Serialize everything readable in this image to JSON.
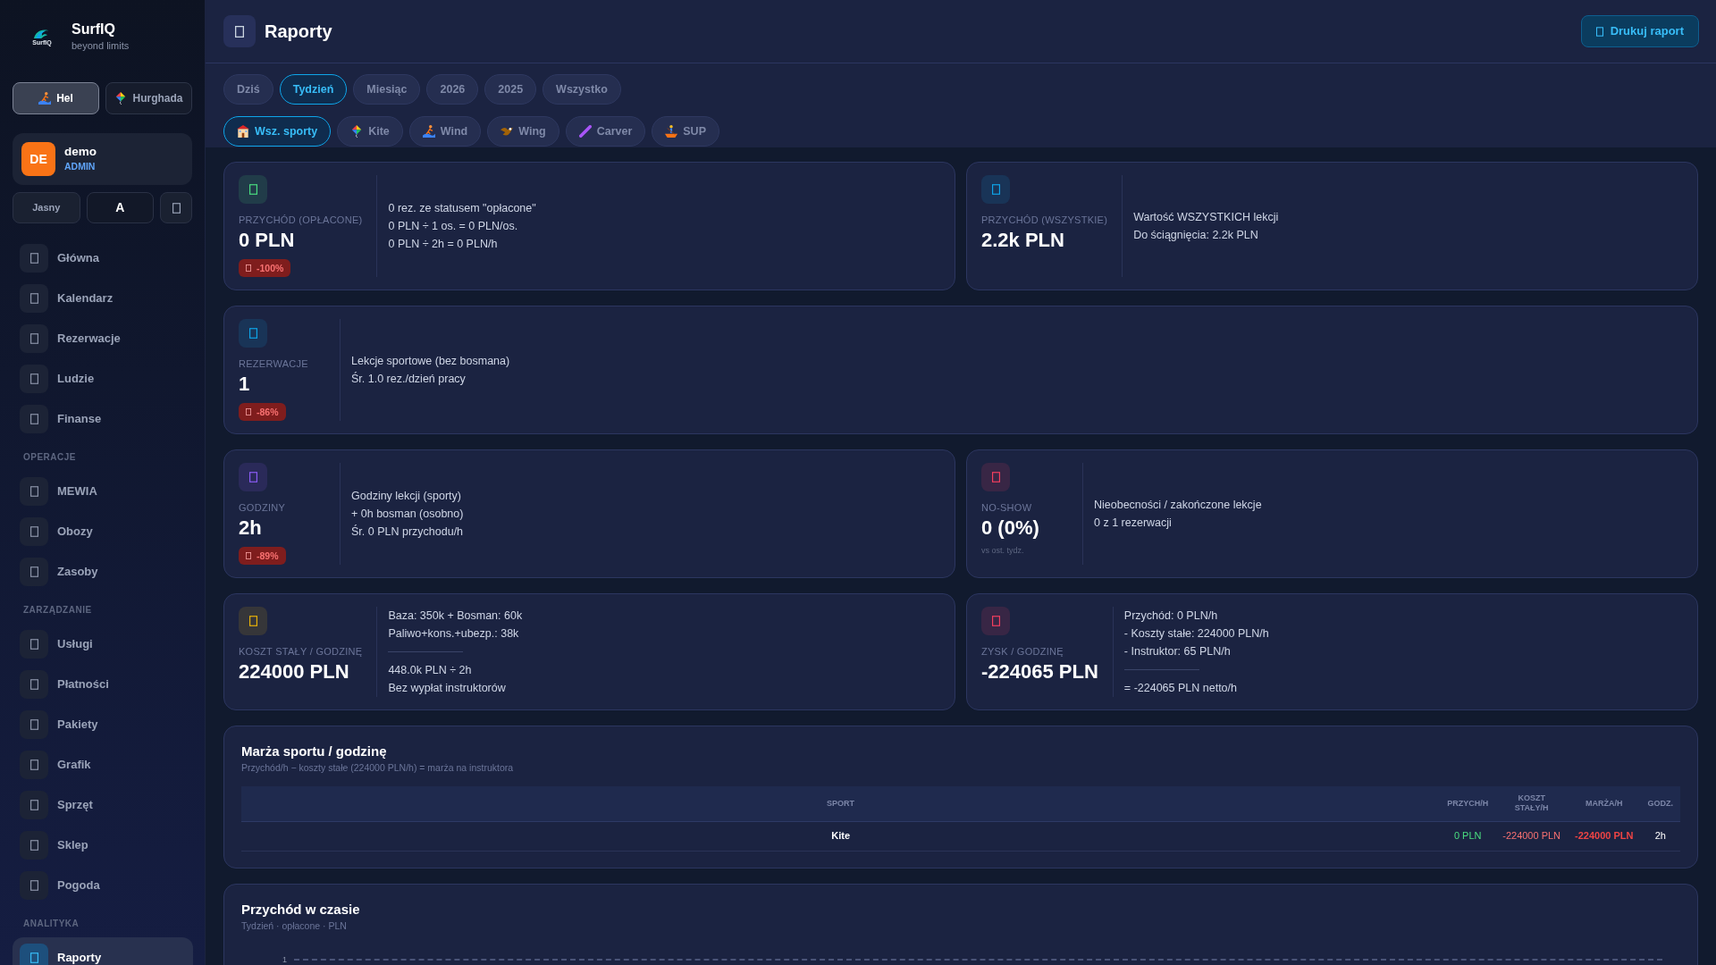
{
  "sidebar": {
    "logo_text": "SurfIQ",
    "brand": "SurfIQ",
    "tagline": "beyond limits",
    "locations": [
      {
        "label": "Hel",
        "selected": true
      },
      {
        "label": "Hurghada",
        "selected": false
      }
    ],
    "user": {
      "initials": "DE",
      "name": "demo",
      "role": "ADMIN"
    },
    "theme_buttons": [
      {
        "label": "Jasny",
        "selected": false
      },
      {
        "label": "A",
        "selected": true
      }
    ],
    "nav_sections": [
      {
        "items": [
          {
            "label": "Główna",
            "selected": false
          },
          {
            "label": "Kalendarz",
            "selected": false
          },
          {
            "label": "Rezerwacje",
            "selected": false
          },
          {
            "label": "Ludzie",
            "selected": false
          },
          {
            "label": "Finanse",
            "selected": false
          }
        ]
      },
      {
        "heading": "OPERACJE",
        "items": [
          {
            "label": "MEWIA",
            "selected": false
          },
          {
            "label": "Obozy",
            "selected": false
          },
          {
            "label": "Zasoby",
            "selected": false
          }
        ]
      },
      {
        "heading": "ZARZĄDZANIE",
        "items": [
          {
            "label": "Usługi",
            "selected": false
          },
          {
            "label": "Płatności",
            "selected": false
          },
          {
            "label": "Pakiety",
            "selected": false
          },
          {
            "label": "Grafik",
            "selected": false
          },
          {
            "label": "Sprzęt",
            "selected": false
          },
          {
            "label": "Sklep",
            "selected": false
          },
          {
            "label": "Pogoda",
            "selected": false
          }
        ]
      },
      {
        "heading": "ANALITYKA",
        "items": [
          {
            "label": "Raporty",
            "selected": true
          }
        ]
      }
    ]
  },
  "header": {
    "title": "Raporty",
    "print_button": "Drukuj raport"
  },
  "period_filters": [
    {
      "label": "Dziś",
      "selected": false
    },
    {
      "label": "Tydzień",
      "selected": true
    },
    {
      "label": "Miesiąc",
      "selected": false
    },
    {
      "label": "2026",
      "selected": false
    },
    {
      "label": "2025",
      "selected": false
    },
    {
      "label": "Wszystko",
      "selected": false
    }
  ],
  "sport_filters": [
    {
      "label": "Wsz. sporty",
      "selected": true
    },
    {
      "label": "Kite",
      "selected": false
    },
    {
      "label": "Wind",
      "selected": false
    },
    {
      "label": "Wing",
      "selected": false
    },
    {
      "label": "Carver",
      "selected": false
    },
    {
      "label": "SUP",
      "selected": false
    }
  ],
  "stat_rows": [
    [
      {
        "label": "PRZYCHÓD (OPŁACONE)",
        "value": "0 PLN",
        "delta": "-100%",
        "color": "#4ade80",
        "details": [
          [
            "0 rez. ze statusem \"opłacone\"",
            "0 PLN ÷ 1 os. = 0 PLN/os.",
            "0 PLN ÷ 2h = 0 PLN/h"
          ]
        ]
      },
      {
        "label": "PRZYCHÓD (WSZYSTKIE)",
        "value": "2.2k PLN",
        "color": "#0ea5e9",
        "details": [
          [
            "Wartość WSZYSTKICH lekcji",
            "Do ściągnięcia: 2.2k PLN"
          ]
        ]
      }
    ],
    [
      {
        "label": "REZERWACJE",
        "value": "1",
        "delta": "-86%",
        "color": "#0ea5e9",
        "details": [
          [
            "Lekcje sportowe (bez bosmana)",
            "Śr. 1.0 rez./dzień pracy"
          ]
        ]
      }
    ],
    [
      {
        "label": "GODZINY",
        "value": "2h",
        "delta": "-89%",
        "color": "#8b5cf6",
        "details": [
          [
            "Godziny lekcji (sporty)",
            "+ 0h bosman (osobno)",
            "Śr. 0 PLN przychodu/h"
          ]
        ]
      },
      {
        "label": "NO-SHOW",
        "value": "0 (0%)",
        "note": "vs ost. tydz.",
        "color": "#f43f5e",
        "details": [
          [
            "Nieobecności / zakończone lekcje",
            "0 z 1 rezerwacji"
          ]
        ]
      }
    ],
    [
      {
        "label": "KOSZT STAŁY / GODZINĘ",
        "value": "224000 PLN",
        "color": "#eab308",
        "details": [
          [
            "Baza: 350k + Bosman: 60k",
            "Paliwo+kons.+ubezp.: 38k"
          ],
          [
            "448.0k PLN ÷ 2h",
            "Bez wypłat instruktorów"
          ]
        ]
      },
      {
        "label": "ZYSK / GODZINĘ",
        "value": "-224065 PLN",
        "color": "#f43f5e",
        "details": [
          [
            "Przychód: 0 PLN/h",
            "- Koszty stałe: 224000 PLN/h",
            "- Instruktor: 65 PLN/h"
          ],
          [
            "= -224065 PLN netto/h"
          ]
        ]
      }
    ]
  ],
  "margin_table": {
    "title": "Marża sportu / godzinę",
    "subtitle": "Przychód/h − koszty stałe (224000 PLN/h) = marża na instruktora",
    "columns": [
      "SPORT",
      "PRZYCH/H",
      "KOSZT STAŁY/H",
      "MARŻA/H",
      "GODZ."
    ],
    "rows": [
      {
        "cells": [
          "Kite",
          "0 PLN",
          "-224000 PLN",
          "-224000 PLN",
          "2h"
        ]
      }
    ]
  },
  "revenue_chart": {
    "title": "Przychód w czasie",
    "subtitle": "Tydzień · opłacone · PLN",
    "y_tick_labels": [
      "1"
    ]
  }
}
